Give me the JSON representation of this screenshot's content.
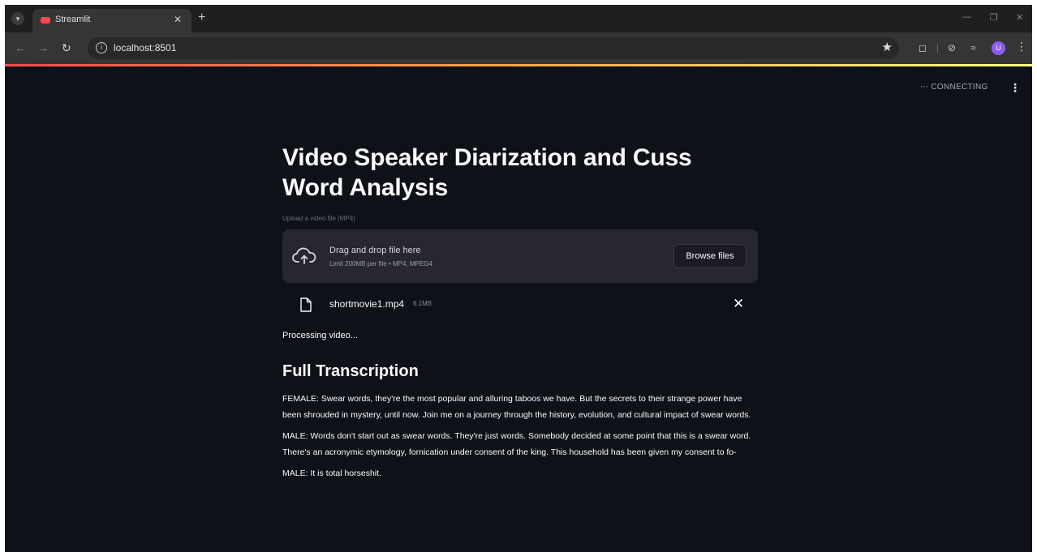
{
  "browser": {
    "tab_title": "Streamlit",
    "url": "localhost:8501"
  },
  "app": {
    "status_text": "CONNECTING",
    "title": "Video Speaker Diarization and Cuss Word Analysis",
    "uploader": {
      "label": "Upload a video file (MP4)",
      "drop_text": "Drag and drop file here",
      "limit_text": "Limit 200MB per file • MP4, MPEG4",
      "browse_label": "Browse files"
    },
    "file": {
      "name": "shortmovie1.mp4",
      "size": "6.1MB"
    },
    "processing_text": "Processing video...",
    "transcription_heading": "Full Transcription",
    "transcript": [
      "FEMALE: Swear words, they're the most popular and alluring taboos we have. But the secrets to their strange power have been shrouded in mystery, until now. Join me on a journey through the history, evolution, and cultural impact of swear words.",
      "MALE: Words don't start out as swear words. They're just words. Somebody decided at some point that this is a swear word. There's an acronymic etymology, fornication under consent of the king. This household has been given my consent to fo-",
      "MALE: It is total horseshit."
    ]
  },
  "colors": {
    "app_background": "#0e1117",
    "dropzone": "#262730",
    "accent": "#ff4b4b"
  }
}
